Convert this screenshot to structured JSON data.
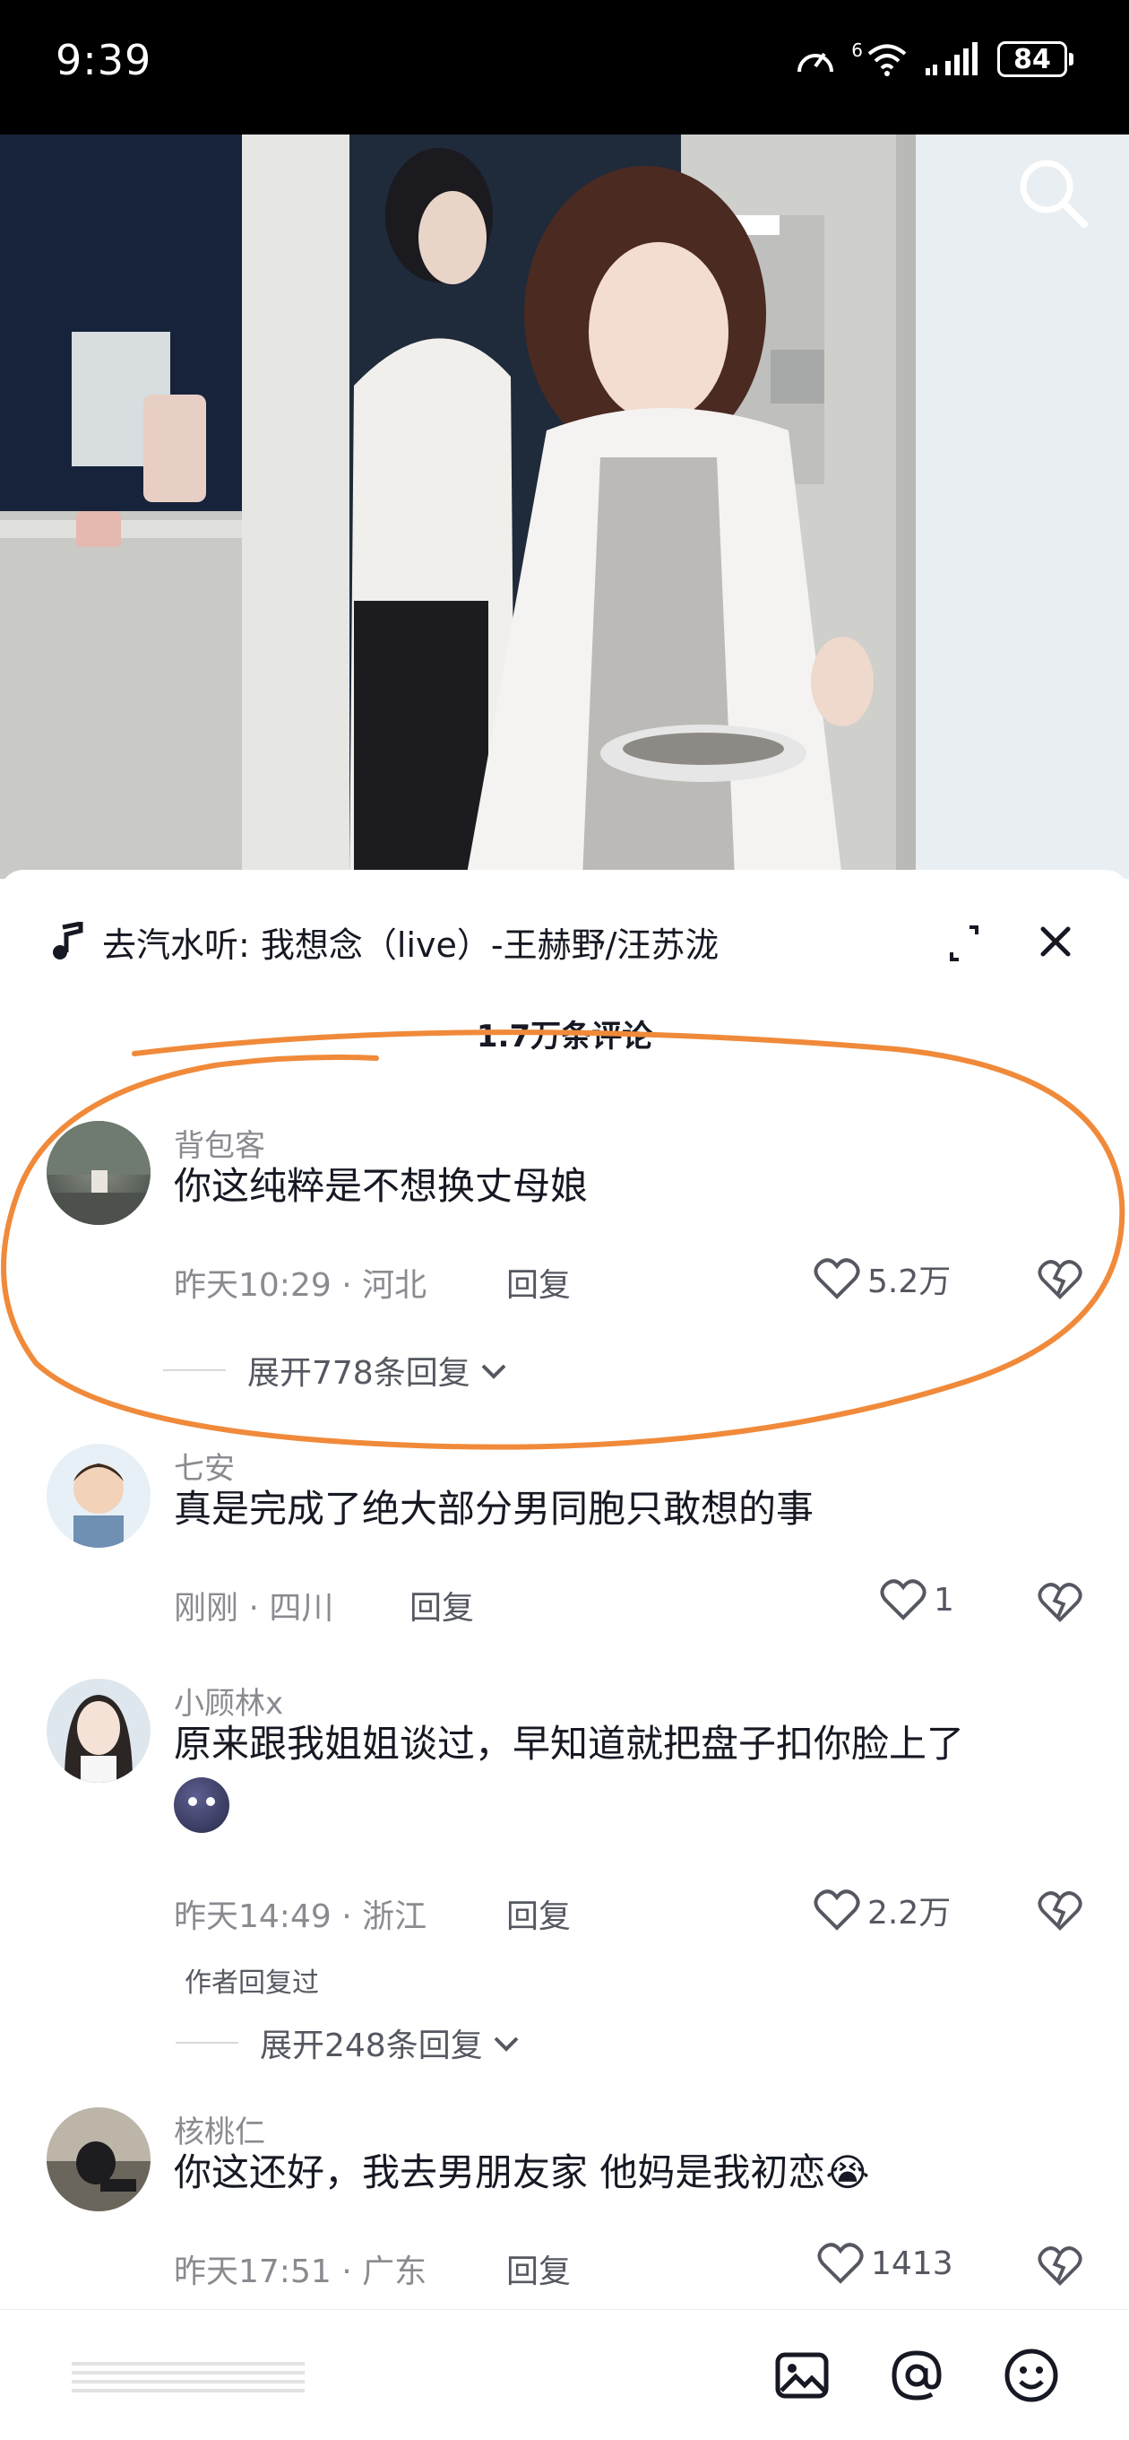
{
  "status_bar": {
    "time": "9:39",
    "network": "6",
    "battery": "84"
  },
  "music": {
    "text": "去汽水听: 我想念（live）-王赫野/汪苏泷"
  },
  "comment_count": "1.7万条评论",
  "comments": [
    {
      "username": "背包客",
      "content": "你这纯粹是不想换丈母娘",
      "time": "昨天10:29",
      "location": "河北",
      "reply_label": "回复",
      "likes": "5.2万",
      "expand_label": "展开778条回复"
    },
    {
      "username": "七安",
      "content": "真是完成了绝大部分男同胞只敢想的事",
      "time": "刚刚",
      "location": "四川",
      "reply_label": "回复",
      "likes": "1"
    },
    {
      "username": "小顾林x",
      "content": "原来跟我姐姐谈过，早知道就把盘子扣你脸上了",
      "time": "昨天14:49",
      "location": "浙江",
      "reply_label": "回复",
      "likes": "2.2万",
      "author_tag": "作者回复过",
      "expand_label": "展开248条回复"
    },
    {
      "username": "核桃仁",
      "content": "你这还好，我去男朋友家 他妈是我初恋😭",
      "time": "昨天17:51",
      "location": "广东",
      "reply_label": "回复",
      "likes": "1413"
    }
  ],
  "separator": " · ",
  "input_bar": {
    "placeholder": ""
  },
  "colors": {
    "annotation": "#f08a3a",
    "text": "#161823",
    "muted": "#8a8b91"
  }
}
